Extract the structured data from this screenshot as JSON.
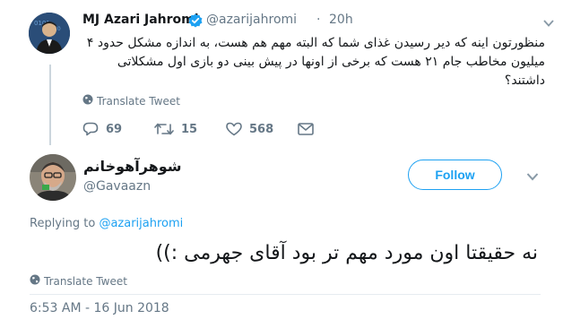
{
  "parent_tweet": {
    "name": "MJ Azari Jahromi",
    "handle": "@azarijahromi",
    "separator": "·",
    "time": "20h",
    "text": "منظورتون اینه که دیر رسیدن غذای شما که البته مهم هم هست، به اندازه مشکل حدود ۴ میلیون مخاطب جام ۲۱ هست که برخی از اونها در پیش بینی دو بازی اول مشکلاتی داشتند؟",
    "translate": "Translate Tweet",
    "replies": "69",
    "retweets": "15",
    "likes": "568",
    "accent": "#1da1f2"
  },
  "reply_tweet": {
    "name": "شوهرآهوخانم",
    "handle": "@Gavaazn",
    "follow_label": "Follow",
    "replying_prefix": "Replying to",
    "replying_to": "@azarijahromi",
    "text": "نه حقیقتا اون مورد مهم تر بود آقای جهرمی :))",
    "translate": "Translate Tweet",
    "timestamp": "6:53 AM - 16 Jun 2018"
  },
  "icons": [
    "globe-icon",
    "reply-icon",
    "retweet-icon",
    "heart-icon",
    "mail-icon",
    "verified-icon",
    "chevron-down-icon"
  ]
}
